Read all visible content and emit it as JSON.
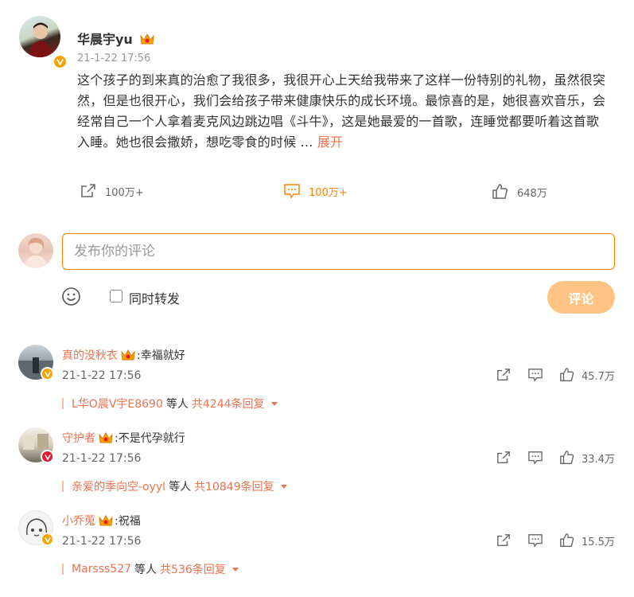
{
  "post": {
    "author": "华晨宇yu",
    "time": "21-1-22 17:56",
    "text": "这个孩子的到来真的治愈了我很多，我很开心上天给我带来了这样一份特别的礼物，虽然很突然，但是也很开心，我们会给孩子带来健康快乐的成长环境。最惊喜的是，她很喜欢音乐，会经常自己一个人拿着麦克风边跳边唱《斗牛》，这是她最爱的一首歌，连睡觉都要听着这首歌入睡。她也很会撒娇，想吃零食的时候 ...",
    "expand_label": "展开",
    "repost_count": "100万+",
    "comment_count": "100万+",
    "like_count": "648万",
    "verified_color": "#f6a300"
  },
  "composer": {
    "placeholder": "发布你的评论",
    "repost_label": "同时转发",
    "submit_label": "评论"
  },
  "comments": [
    {
      "name": "真的没秋衣",
      "text": ":幸福就好",
      "time": "21-1-22 17:56",
      "likes": "45.7万",
      "reply_user": "L华O晨V宇E8690",
      "reply_mid": "等人",
      "reply_count": "共4244条回复"
    },
    {
      "name": "守护者",
      "text": ":不是代孕就行",
      "time": "21-1-22 17:56",
      "likes": "33.4万",
      "reply_user": "亲爱的季向空-oyyl",
      "reply_mid": "等人",
      "reply_count": "共10849条回复"
    },
    {
      "name": "小乔蒐",
      "text": ":祝福",
      "time": "21-1-22 17:56",
      "likes": "15.5万",
      "reply_user": "Marsss527",
      "reply_mid": "等人",
      "reply_count": "共536条回复"
    }
  ],
  "colors": {
    "accent": "#ff8200",
    "link": "#eb7350",
    "submit_bg": "#ffc483"
  }
}
